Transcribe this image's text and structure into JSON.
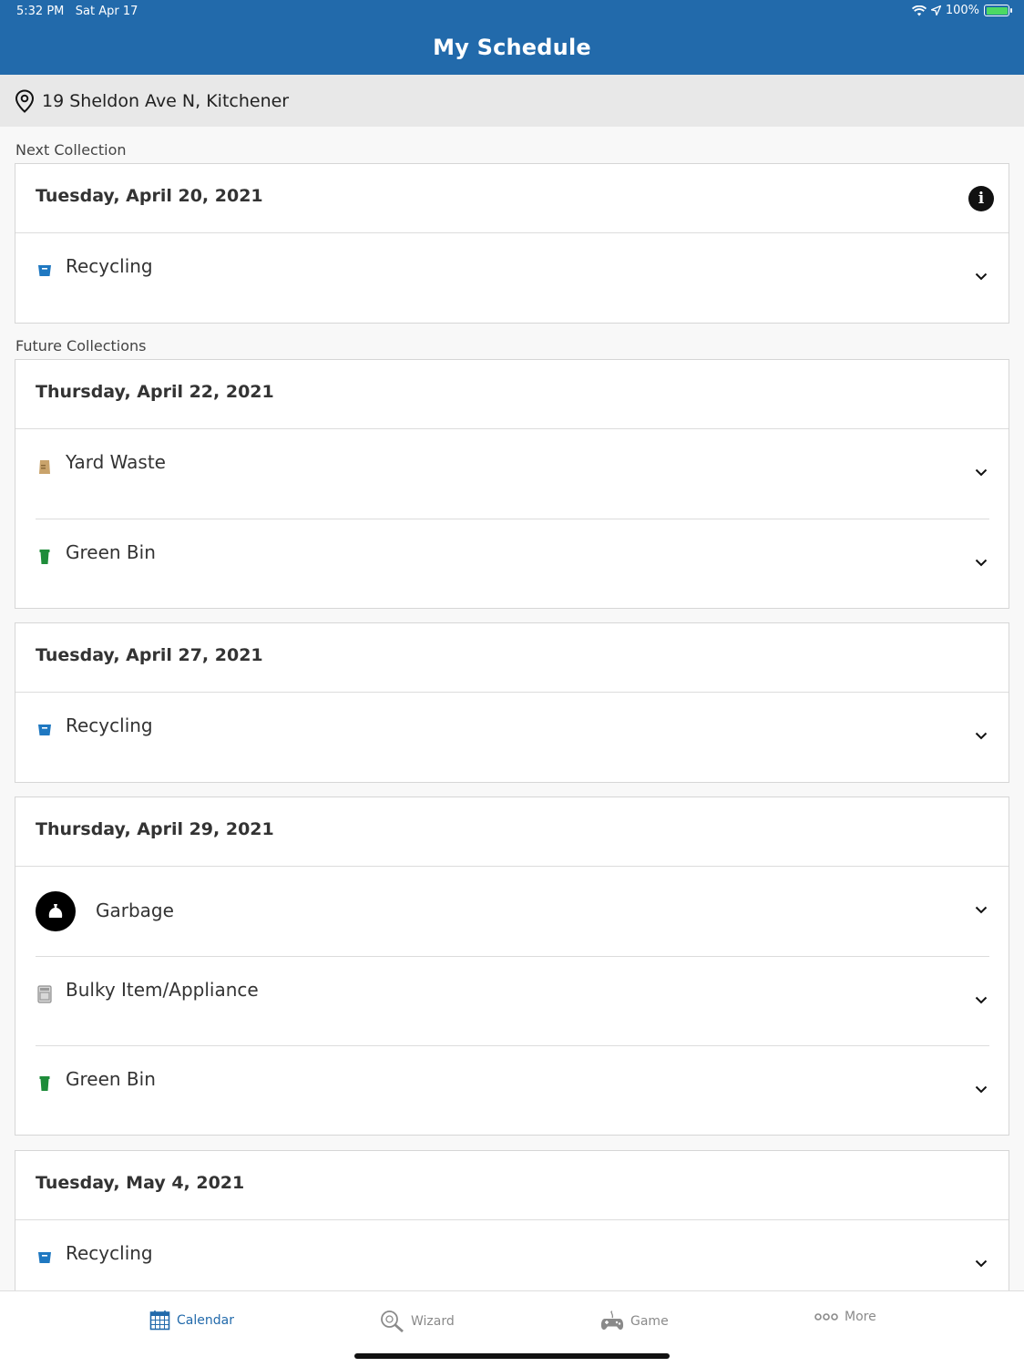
{
  "status": {
    "time": "5:32 PM",
    "date": "Sat Apr 17",
    "battery": "100%"
  },
  "nav": {
    "title": "My Schedule"
  },
  "address": {
    "text": "19 Sheldon Ave N, Kitchener",
    "icon": "location-pin-icon"
  },
  "sections": {
    "next": "Next Collection",
    "future": "Future Collections"
  },
  "cards": [
    {
      "date": "Tuesday, April 20, 2021",
      "items": [
        {
          "label": "Recycling",
          "icon": "recycling-bin-icon",
          "color": "#1f78c1"
        }
      ]
    },
    {
      "date": "Thursday, April 22, 2021",
      "items": [
        {
          "label": "Yard Waste",
          "icon": "yard-waste-bag-icon",
          "color": "#c9a36b"
        },
        {
          "label": "Green Bin",
          "icon": "green-bin-icon",
          "color": "#1e8c3a"
        }
      ]
    },
    {
      "date": "Tuesday, April 27, 2021",
      "items": [
        {
          "label": "Recycling",
          "icon": "recycling-bin-icon",
          "color": "#1f78c1"
        }
      ]
    },
    {
      "date": "Thursday, April 29, 2021",
      "items": [
        {
          "label": "Garbage",
          "icon": "garbage-bag-icon",
          "color": "#000000"
        },
        {
          "label": "Bulky Item/Appliance",
          "icon": "appliance-icon",
          "color": "#9a9a9a"
        },
        {
          "label": "Green Bin",
          "icon": "green-bin-icon",
          "color": "#1e8c3a"
        }
      ]
    },
    {
      "date": "Tuesday, May 4, 2021",
      "items": [
        {
          "label": "Recycling",
          "icon": "recycling-bin-icon",
          "color": "#1f78c1"
        }
      ]
    }
  ],
  "tabs": [
    {
      "label": "Calendar",
      "icon": "calendar-icon",
      "active": true
    },
    {
      "label": "Wizard",
      "icon": "wizard-search-icon",
      "active": false
    },
    {
      "label": "Game",
      "icon": "game-controller-icon",
      "active": false
    },
    {
      "label": "More",
      "icon": "more-dots-icon",
      "active": false
    }
  ],
  "colors": {
    "brand": "#226aab",
    "recycling": "#1f78c1",
    "green_bin": "#1e8c3a"
  }
}
